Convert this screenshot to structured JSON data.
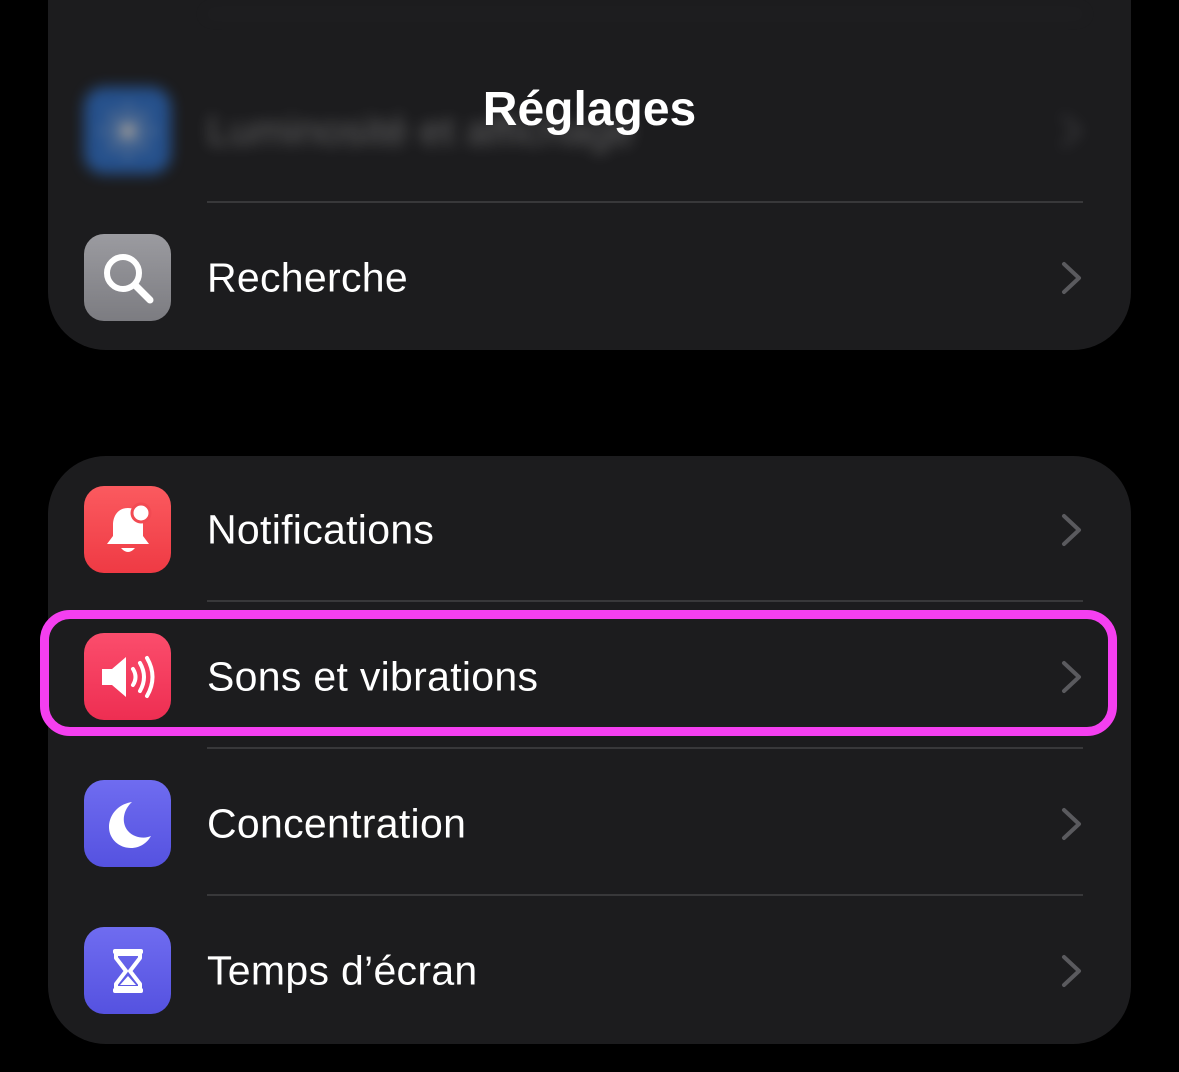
{
  "nav": {
    "title": "Réglages"
  },
  "top_group": {
    "rows": [
      {
        "label": "",
        "icon": "gear-icon",
        "icon_color": "#4a8fa8",
        "blurred": true
      },
      {
        "label": "Luminosité et affichage",
        "icon": "sun-icon",
        "icon_color": "#2e7ce6",
        "blurred": true
      },
      {
        "label": "Recherche",
        "icon": "search-icon",
        "icon_color": "#8e8e93",
        "blurred": false
      }
    ]
  },
  "main_group": {
    "rows": [
      {
        "label": "Notifications",
        "icon": "bell-icon",
        "icon_color": "#f6484f",
        "highlighted": false
      },
      {
        "label": "Sons et vibrations",
        "icon": "speaker-icon",
        "icon_color": "#f43e5e",
        "highlighted": true
      },
      {
        "label": "Concentration",
        "icon": "moon-icon",
        "icon_color": "#5e5ce6",
        "highlighted": false
      },
      {
        "label": "Temps d’écran",
        "icon": "hourglass-icon",
        "icon_color": "#5e5ce6",
        "highlighted": false
      }
    ]
  },
  "colors": {
    "background": "#000000",
    "group_background": "#1c1c1e",
    "separator": "#38383a",
    "chevron": "#5a5a5e",
    "highlight": "#f43ff0"
  }
}
